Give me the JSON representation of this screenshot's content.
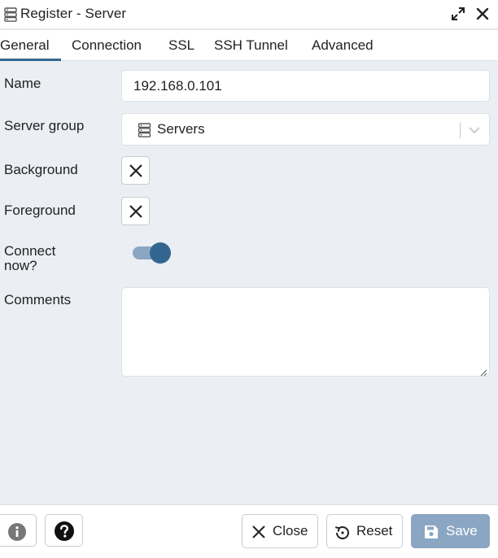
{
  "window": {
    "title": "Register - Server",
    "title_icon": "server-icon",
    "expand_icon": "expand-icon",
    "close_icon": "close-icon"
  },
  "tabs": [
    {
      "label": "General",
      "active": true
    },
    {
      "label": "Connection",
      "active": false
    },
    {
      "label": "SSL",
      "active": false
    },
    {
      "label": "SSH Tunnel",
      "active": false
    },
    {
      "label": "Advanced",
      "active": false
    }
  ],
  "form": {
    "name_label": "Name",
    "name_value": "192.168.0.101",
    "server_group_label": "Server group",
    "server_group_value": "Servers",
    "background_label": "Background",
    "foreground_label": "Foreground",
    "connect_now_label_line1": "Connect",
    "connect_now_label_line2": "now?",
    "connect_now_value": true,
    "comments_label": "Comments",
    "comments_value": ""
  },
  "footer": {
    "info_icon": "info-icon",
    "help_icon": "help-icon",
    "close_label": "Close",
    "reset_label": "Reset",
    "save_label": "Save"
  },
  "colors": {
    "accent": "#326690",
    "accent_light": "#8aa6c3",
    "background": "#ebeef3"
  }
}
